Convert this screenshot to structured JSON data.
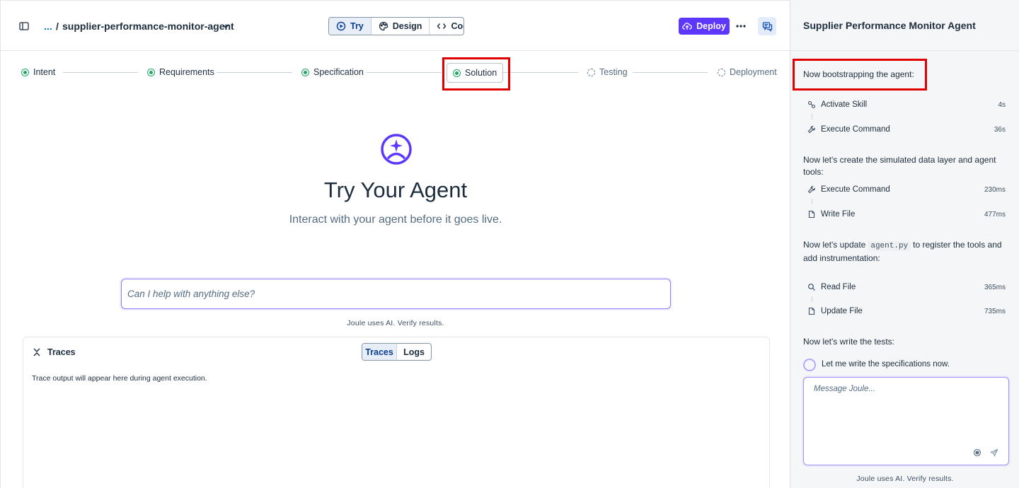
{
  "header": {
    "breadcrumb_ellipsis": "...",
    "breadcrumb_separator": "/",
    "project_name": "supplier-performance-monitor-agent",
    "modes": [
      {
        "label": "Try",
        "icon": "try-icon",
        "active": true
      },
      {
        "label": "Design",
        "icon": "palette-icon",
        "active": false
      },
      {
        "label": "Code",
        "icon": "code-icon",
        "active": false
      }
    ],
    "deploy_label": "Deploy",
    "accent_color": "#5d36ff"
  },
  "stepper": {
    "steps": [
      {
        "label": "Intent",
        "status": "done"
      },
      {
        "label": "Requirements",
        "status": "done"
      },
      {
        "label": "Specification",
        "status": "done"
      },
      {
        "label": "Solution",
        "status": "current"
      },
      {
        "label": "Testing",
        "status": "pending"
      },
      {
        "label": "Deployment",
        "status": "pending"
      }
    ]
  },
  "hero": {
    "title": "Try Your Agent",
    "subtitle": "Interact with your agent before it goes live."
  },
  "chat": {
    "placeholder": "Can I help with anything else?",
    "ai_note": "Joule uses AI. Verify results."
  },
  "traces": {
    "title": "Traces",
    "tabs": [
      {
        "label": "Traces",
        "active": true
      },
      {
        "label": "Logs",
        "active": false
      }
    ],
    "empty_text": "Trace output will appear here during agent execution."
  },
  "side": {
    "title": "Supplier Performance Monitor Agent",
    "msg1": "Now bootstrapping the agent:",
    "group1": [
      {
        "label": "Activate Skill",
        "icon": "skill-icon",
        "duration": "4s"
      },
      {
        "label": "Execute Command",
        "icon": "wrench-icon",
        "duration": "36s"
      }
    ],
    "msg2": "Now let's create the simulated data layer and agent tools:",
    "group2": [
      {
        "label": "Execute Command",
        "icon": "wrench-icon",
        "duration": "230ms"
      },
      {
        "label": "Write File",
        "icon": "file-icon",
        "duration": "477ms"
      }
    ],
    "msg3_before": "Now let's update",
    "msg3_code": "agent.py",
    "msg3_after": "to register the tools and add instrumentation:",
    "group3": [
      {
        "label": "Read File",
        "icon": "search-icon",
        "duration": "365ms"
      },
      {
        "label": "Update File",
        "icon": "file-icon",
        "duration": "735ms"
      }
    ],
    "msg4": "Now let's write the tests:",
    "progress_text": "Let me write the specifications now.",
    "message_placeholder": "Message Joule...",
    "ai_note": "Joule uses AI. Verify results."
  }
}
